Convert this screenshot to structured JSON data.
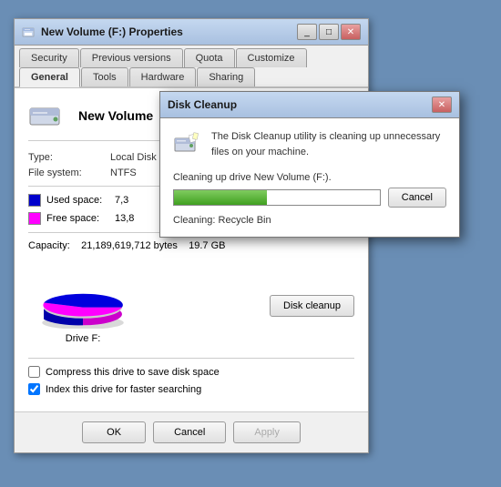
{
  "main_window": {
    "title": "New Volume (F:) Properties",
    "tabs_row1": [
      {
        "label": "Security",
        "active": false
      },
      {
        "label": "Previous versions",
        "active": false
      },
      {
        "label": "Quota",
        "active": false
      },
      {
        "label": "Customize",
        "active": false
      }
    ],
    "tabs_row2": [
      {
        "label": "General",
        "active": true
      },
      {
        "label": "Tools",
        "active": false
      },
      {
        "label": "Hardware",
        "active": false
      },
      {
        "label": "Sharing",
        "active": false
      }
    ],
    "drive_name": "New Volume",
    "type_label": "Type:",
    "type_value": "Local Disk",
    "filesystem_label": "File system:",
    "filesystem_value": "NTFS",
    "used_space_label": "Used space:",
    "used_space_value": "7,3",
    "free_space_label": "Free space:",
    "free_space_value": "13,8",
    "capacity_label": "Capacity:",
    "capacity_bytes": "21,189,619,712 bytes",
    "capacity_gb": "19.7 GB",
    "drive_label": "Drive F:",
    "disk_cleanup_btn": "Disk cleanup",
    "compress_label": "Compress this drive to save disk space",
    "index_label": "Index this drive for faster searching",
    "ok_btn": "OK",
    "cancel_btn": "Cancel",
    "apply_btn": "Apply"
  },
  "cleanup_dialog": {
    "title": "Disk Cleanup",
    "message": "The Disk Cleanup utility is cleaning up unnecessary files\non your machine.",
    "progress_label": "Cleaning up drive New Volume (F:).",
    "progress_percent": 45,
    "cancel_btn": "Cancel",
    "cleaning_status": "Cleaning:   Recycle Bin"
  },
  "colors": {
    "used": "#0000cc",
    "free": "#ff00ff",
    "progress_green": "#40a020"
  }
}
